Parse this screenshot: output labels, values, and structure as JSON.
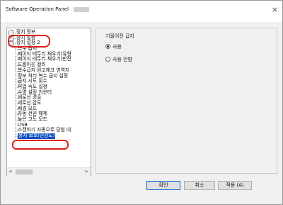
{
  "window": {
    "title": "Software Operation Panel",
    "close_glyph": "×"
  },
  "tree": {
    "items": [
      {
        "label": "장치 정보",
        "level": 0,
        "expander": "-"
      },
      {
        "label": "장치 설정",
        "level": 0,
        "expander": "+"
      },
      {
        "label": "장치 설정 2",
        "level": 0,
        "expander": "-"
      },
      {
        "label": "복수 급지",
        "level": 1
      },
      {
        "label": "페이지 테두리 채우기(유형",
        "level": 1
      },
      {
        "label": "페이지 테두리 채우기(반전",
        "level": 1
      },
      {
        "label": "드롭아웃 컬러",
        "level": 1
      },
      {
        "label": "복수급지 원고체크 영역지",
        "level": 1
      },
      {
        "label": "정보 처리 복수 급지 설정",
        "level": 1
      },
      {
        "label": "급지 시도 횟수",
        "level": 1
      },
      {
        "label": "픽업 속도 설정",
        "level": 1
      },
      {
        "label": "수명 설정 카운터",
        "level": 1
      },
      {
        "label": "세로선 경출",
        "level": 1
      },
      {
        "label": "세로선 감도",
        "level": 1
      },
      {
        "label": "배경 모드",
        "level": 1
      },
      {
        "label": "자동 전원 해제",
        "level": 1
      },
      {
        "label": "높은 고도 모드",
        "level": 1
      },
      {
        "label": "USB",
        "level": 1
      },
      {
        "label": "스캔하기 자동으로 닫힘 대",
        "level": 1
      },
      {
        "label": "용지 보호(민감도)",
        "level": 1,
        "selected": true
      }
    ]
  },
  "content": {
    "group_label": "기울어진 급지",
    "options": [
      {
        "label": "사용",
        "checked": true
      },
      {
        "label": "사용 안함",
        "checked": false
      }
    ]
  },
  "buttons": {
    "ok": "확인",
    "cancel": "취소",
    "apply": "적용 (A)"
  },
  "scroll": {
    "left": "<",
    "right": ">"
  },
  "colors": {
    "selection": "#0a4fc4",
    "annotation_ring": "#e0201a"
  }
}
